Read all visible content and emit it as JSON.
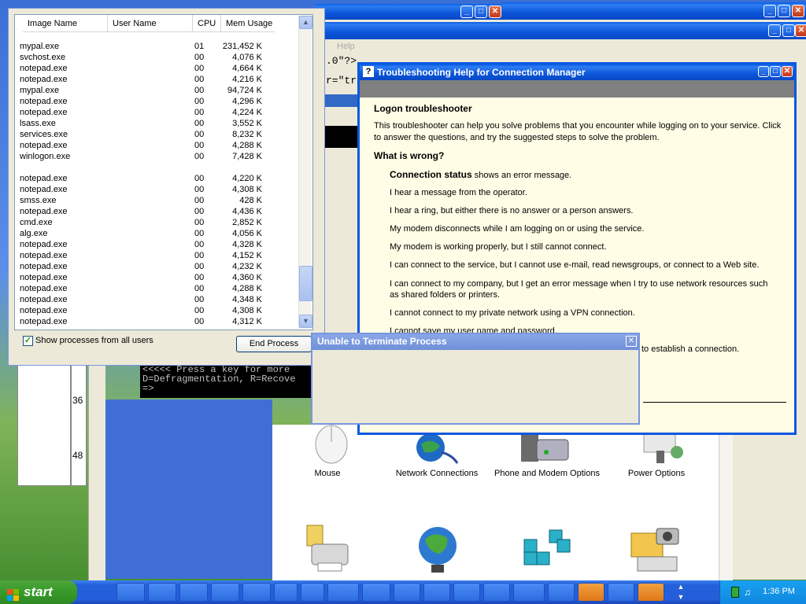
{
  "task_manager": {
    "columns": [
      "Image Name",
      "User Name",
      "CPU",
      "Mem Usage"
    ],
    "rows": [
      [
        "mypal.exe",
        "",
        "01",
        "231,452 K"
      ],
      [
        "svchost.exe",
        "",
        "00",
        "4,076 K"
      ],
      [
        "notepad.exe",
        "",
        "00",
        "4,664 K"
      ],
      [
        "notepad.exe",
        "",
        "00",
        "4,216 K"
      ],
      [
        "mypal.exe",
        "",
        "00",
        "94,724 K"
      ],
      [
        "notepad.exe",
        "",
        "00",
        "4,296 K"
      ],
      [
        "notepad.exe",
        "",
        "00",
        "4,224 K"
      ],
      [
        "lsass.exe",
        "",
        "00",
        "3,552 K"
      ],
      [
        "services.exe",
        "",
        "00",
        "8,232 K"
      ],
      [
        "notepad.exe",
        "",
        "00",
        "4,288 K"
      ],
      [
        "winlogon.exe",
        "",
        "00",
        "7,428 K"
      ],
      [
        "",
        "",
        "",
        ""
      ],
      [
        "notepad.exe",
        "",
        "00",
        "4,220 K"
      ],
      [
        "notepad.exe",
        "",
        "00",
        "4,308 K"
      ],
      [
        "smss.exe",
        "",
        "00",
        "428 K"
      ],
      [
        "notepad.exe",
        "",
        "00",
        "4,436 K"
      ],
      [
        "cmd.exe",
        "",
        "00",
        "2,852 K"
      ],
      [
        "alg.exe",
        "",
        "00",
        "4,056 K"
      ],
      [
        "notepad.exe",
        "",
        "00",
        "4,328 K"
      ],
      [
        "notepad.exe",
        "",
        "00",
        "4,152 K"
      ],
      [
        "notepad.exe",
        "",
        "00",
        "4,232 K"
      ],
      [
        "notepad.exe",
        "",
        "00",
        "4,360 K"
      ],
      [
        "notepad.exe",
        "",
        "00",
        "4,288 K"
      ],
      [
        "notepad.exe",
        "",
        "00",
        "4,348 K"
      ],
      [
        "notepad.exe",
        "",
        "00",
        "4,308 K"
      ],
      [
        "notepad.exe",
        "",
        "00",
        "4,312 K"
      ]
    ],
    "show_all_label": "Show processes from all users",
    "show_all_checked": true,
    "end_process_label": "End Process"
  },
  "help_window": {
    "title": "Troubleshooting Help for Connection Manager",
    "heading": "Logon troubleshooter",
    "intro": "This troubleshooter can help you solve problems that you encounter while logging on to your service. Click to answer the questions, and try the suggested steps to solve the problem.",
    "question": "What is wrong?",
    "item0_bold": "Connection status",
    "item0_rest": " shows an error message.",
    "items": [
      "I hear a message from the operator.",
      "I hear a ring, but either there is no answer or a person answers.",
      "My modem disconnects while I am logging on or using the service.",
      "My modem is working properly, but I still cannot connect.",
      "I can connect to the service, but I cannot use e-mail, read newsgroups, or connect to a Web site.",
      "I can connect to my company, but I get an error message when I try to use network resources such as shared folders or printers.",
      "I cannot connect to my private network using a VPN connection.",
      "I cannot save my user name and password."
    ],
    "partial_line": "to establish a connection."
  },
  "error_dialog": {
    "title": "Unable to Terminate Process"
  },
  "console": {
    "line1": "<<<<<  Press a key for more",
    "line2": "D=Defragmentation, R=Recove",
    "line3": "=>"
  },
  "background_window": {
    "snippet1": ".0\"?>",
    "snippet2": "r=\"tr",
    "menu_help": "Help",
    "ruler_36": "36",
    "ruler_48": "48"
  },
  "control_panel": {
    "items": [
      "Mouse",
      "Network Connections",
      "Phone and Modem Options",
      "Power Options"
    ]
  },
  "taskbar": {
    "start_label": "start",
    "clock": "1:36 PM"
  }
}
